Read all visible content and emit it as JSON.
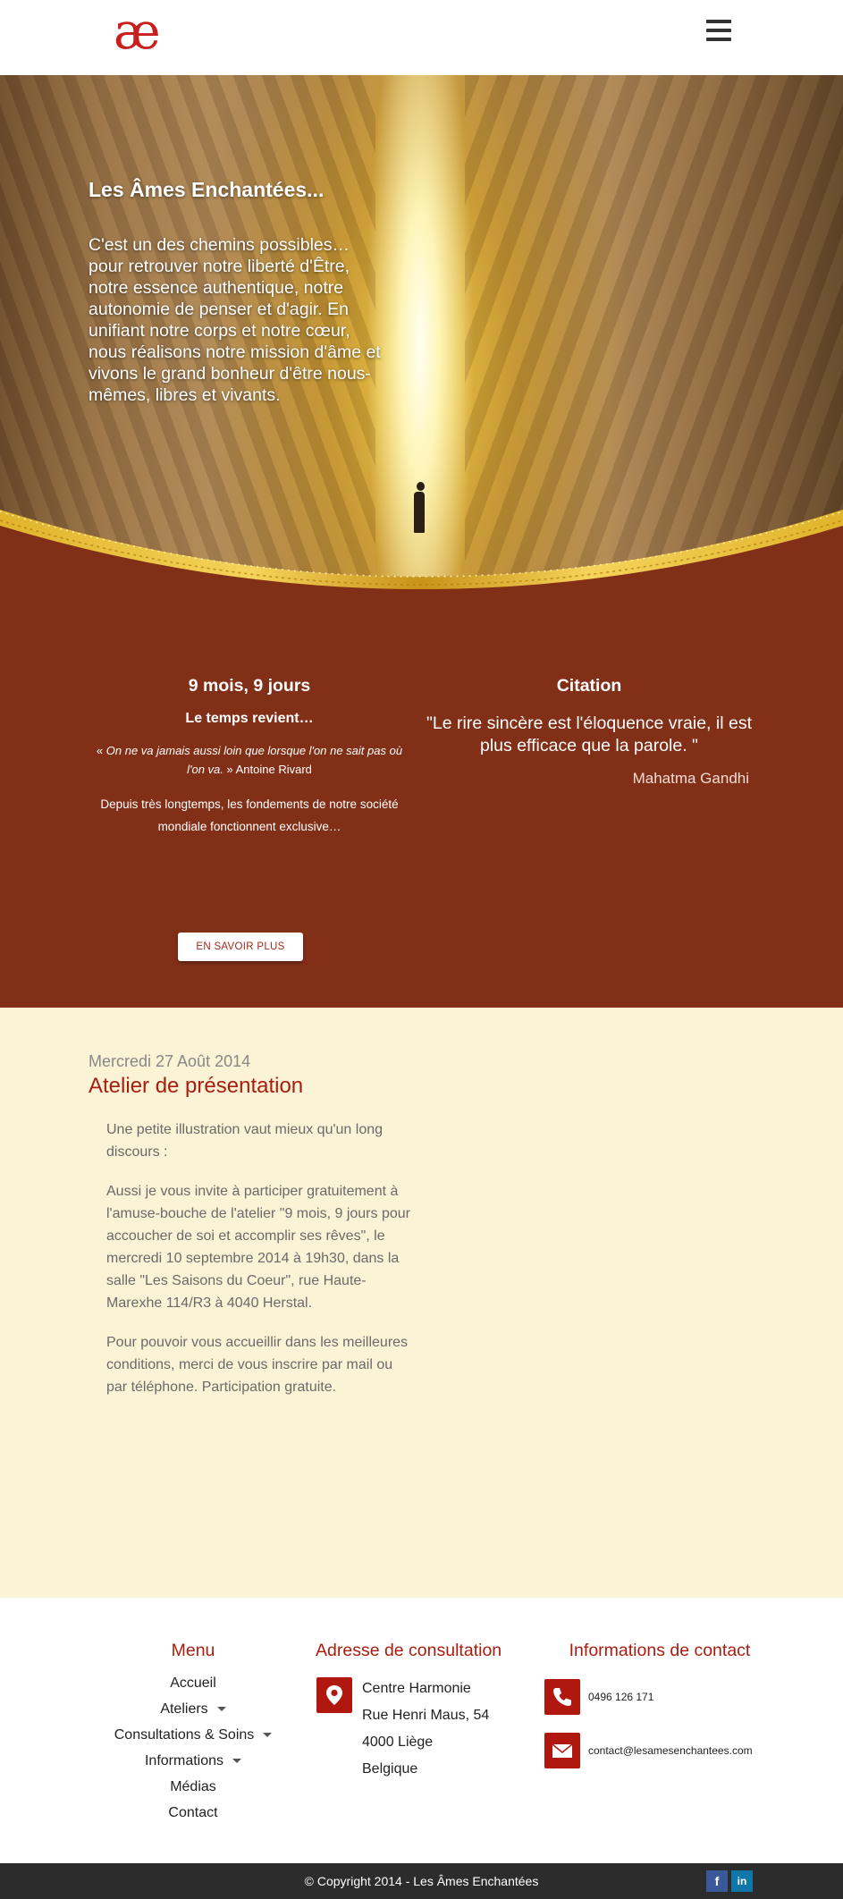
{
  "header": {
    "logo_text": "æ",
    "menu_icon": "hamburger-menu-icon"
  },
  "hero": {
    "title": "Les Âmes Enchantées...",
    "text": "C'est un des chemins possibles… pour retrouver notre liberté d'Être, notre essence authentique, notre autonomie de penser et d'agir. En unifiant notre corps et notre cœur, nous réalisons notre mission d'âme et vivons le grand bonheur d'être nous-mêmes, libres et vivants."
  },
  "workshop": {
    "heading": "9 mois, 9 jours",
    "subheading": "Le temps revient…",
    "quote_open": "« ",
    "quote_text": "On ne va jamais aussi loin que lorsque l'on ne sait pas où l'on va.",
    "quote_author": " » Antoine Rivard",
    "intro": "Depuis très longtemps, les fondements de notre société mondiale fonctionnent exclusive…",
    "button_label": "EN SAVOIR PLUS"
  },
  "citation": {
    "heading": "Citation",
    "text": "\"Le rire sincère est l'éloquence vraie, il est plus efficace que la parole. \"",
    "author": "Mahatma Gandhi"
  },
  "post": {
    "date": "Mercredi 27 Août 2014",
    "title": "Atelier de présentation",
    "paragraphs": [
      "Une petite illustration vaut mieux qu'un long discours :",
      "Aussi je vous invite à participer gratuitement à l'amuse-bouche de l'atelier \"9 mois, 9 jours pour accoucher de soi et accomplir ses rêves\", le mercredi 10 septembre 2014 à 19h30, dans la salle \"Les Saisons du Coeur\", rue Haute-Marexhe 114/R3 à 4040 Herstal.",
      "Pour pouvoir vous accueillir dans les meilleures conditions, merci de vous inscrire par mail ou par téléphone. Participation gratuite."
    ]
  },
  "footer": {
    "menu": {
      "heading": "Menu",
      "items": [
        "Accueil",
        "Ateliers",
        "Consultations & Soins",
        "Informations",
        "Médias",
        "Contact"
      ]
    },
    "address": {
      "heading": "Adresse de consultation",
      "lines": [
        "Centre Harmonie",
        "Rue Henri Maus, 54",
        "4000 Liège",
        "Belgique"
      ],
      "icon": "map-pin-icon"
    },
    "contact": {
      "heading": "Informations de contact",
      "phone": "0496 126 171",
      "email": "contact@lesamesenchantees.com",
      "phone_icon": "phone-icon",
      "email_icon": "envelope-icon"
    },
    "copyright": "© Copyright 2014 - Les Âmes Enchantées",
    "social": {
      "facebook": "f",
      "linkedin": "in"
    }
  },
  "colors": {
    "accent_red": "#a91d10",
    "section_brown": "#822f17",
    "cream": "#fbf3d5",
    "footer_bar": "#2c2c2c"
  }
}
